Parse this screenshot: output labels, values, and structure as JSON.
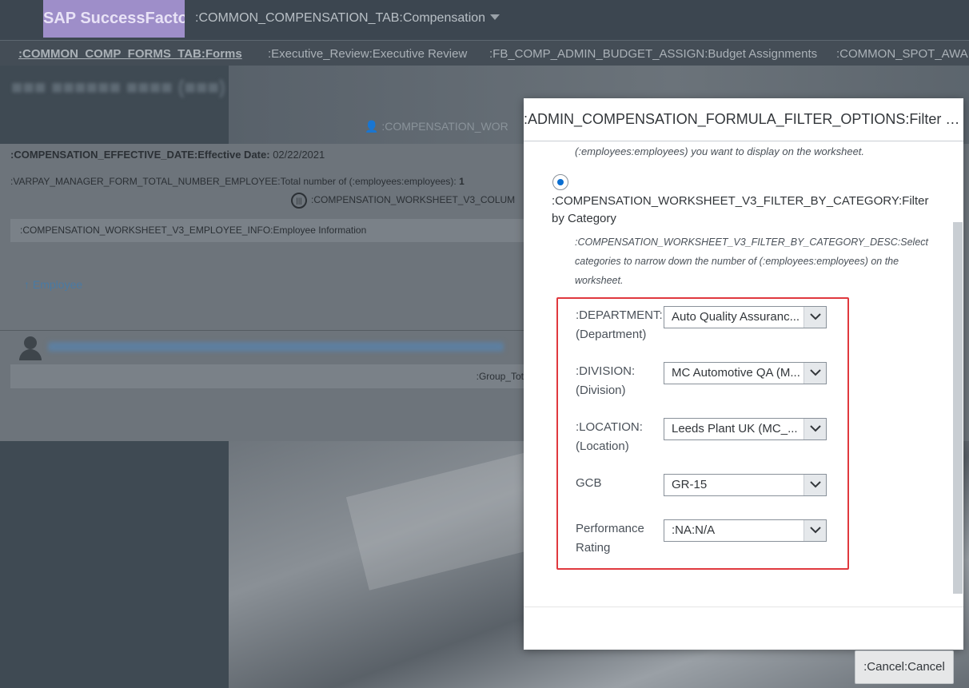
{
  "shell": {
    "logo": "SAP SuccessFacto",
    "module": ":COMMON_COMPENSATION_TAB:Compensation"
  },
  "tabs": [
    {
      "label": ":COMMON_COMP_FORMS_TAB:Forms",
      "active": true
    },
    {
      "label": ":Executive_Review:Executive Review",
      "active": false
    },
    {
      "label": ":FB_COMP_ADMIN_BUDGET_ASSIGN:Budget Assignments",
      "active": false
    },
    {
      "label": ":COMMON_SPOT_AWAR",
      "active": false
    }
  ],
  "worksheet": {
    "sub": ":COMPENSATION_WOR",
    "effective_date_label": ":COMPENSATION_EFFECTIVE_DATE:Effective Date:",
    "effective_date": "02/22/2021",
    "total_employees_label": ":VARPAY_MANAGER_FORM_TOTAL_NUMBER_EMPLOYEE:Total number of (:employees:employees):",
    "total_employees": "1",
    "columns_label": ":COMPENSATION_WORKSHEET_V3_COLUM",
    "employee_info": ":COMPENSATION_WORKSHEET_V3_EMPLOYEE_INFO:Employee Information",
    "employee_sort": "Employee",
    "group_total": ":Group_Tot"
  },
  "modal": {
    "title": ":ADMIN_COMPENSATION_FORMULA_FILTER_OPTIONS:Filter Opti...",
    "desc_top": "(:employees:employees) you want to display on the worksheet.",
    "radio_label": ":COMPENSATION_WORKSHEET_V3_FILTER_BY_CATEGORY:Filter by Category",
    "category_desc": ":COMPENSATION_WORKSHEET_V3_FILTER_BY_CATEGORY_DESC:Select categories to narrow down the number of (:employees:employees) on the worksheet.",
    "filters": [
      {
        "label": ":DEPARTMENT: (Department)",
        "value": "Auto Quality Assuranc..."
      },
      {
        "label": ":DIVISION: (Division)",
        "value": "MC Automotive QA (M..."
      },
      {
        "label": ":LOCATION: (Location)",
        "value": "Leeds Plant UK (MC_..."
      },
      {
        "label": "GCB",
        "value": "GR-15"
      },
      {
        "label": "Performance Rating",
        "value": ":NA:N/A"
      }
    ]
  },
  "cancel_button": ":Cancel:Cancel",
  "colors": {
    "accent": "#0a6ed1",
    "highlight_box": "#e0393e",
    "logo_bg": "#9e8ec9"
  }
}
